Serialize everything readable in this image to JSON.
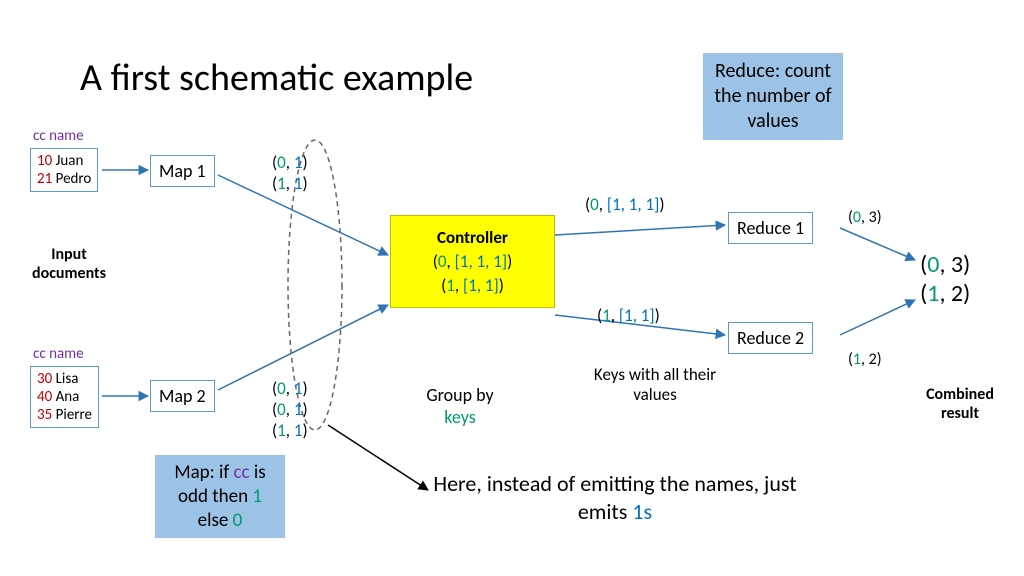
{
  "title": "A first schematic example",
  "cc_header": "cc name",
  "doc1": {
    "rows": [
      [
        "10",
        "Juan"
      ],
      [
        "21",
        "Pedro"
      ]
    ]
  },
  "doc2": {
    "rows": [
      [
        "30",
        "Lisa"
      ],
      [
        "40",
        "Ana"
      ],
      [
        "35",
        "Pierre"
      ]
    ]
  },
  "map1": "Map 1",
  "map2": "Map 2",
  "input_docs": "Input\ndocuments",
  "map_rule_pre": "Map: if ",
  "map_rule_cc": "cc",
  "map_rule_mid": " is odd then ",
  "map_rule_one": "1",
  "map_rule_else": " else ",
  "map_rule_zero": "0",
  "pairs1": [
    [
      "0",
      "1"
    ],
    [
      "1",
      "1"
    ]
  ],
  "pairs2": [
    [
      "0",
      "1"
    ],
    [
      "0",
      "1"
    ],
    [
      "1",
      "1"
    ]
  ],
  "controller": "Controller",
  "ctrl_line1_key": "0",
  "ctrl_line1_vals": "[1, 1, 1]",
  "ctrl_line2_key": "1",
  "ctrl_line2_vals": "[1, 1]",
  "groupby": "Group by",
  "groupby_k": "keys",
  "keys_label": "Keys with all their values",
  "out1_key": "0",
  "out1_vals": "[1, 1, 1]",
  "out2_key": "1",
  "out2_vals": "[1, 1]",
  "reduce_desc": "Reduce: count the number of values",
  "reduce1": "Reduce 1",
  "reduce2": "Reduce 2",
  "r1_key": "0",
  "r1_val": "3",
  "r2_key": "1",
  "r2_val": "2",
  "combined": "Combined\nresult",
  "final1_key": "0",
  "final1_val": "3",
  "final2_key": "1",
  "final2_val": "2",
  "footer1": "Here, instead of emitting the names, just emits ",
  "footer_1s": "1s"
}
